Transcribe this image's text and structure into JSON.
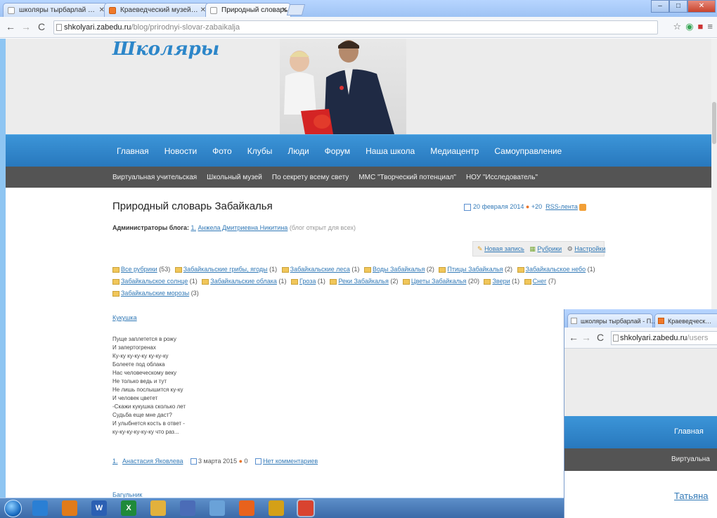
{
  "browser": {
    "tabs": [
      {
        "label": "школяры тырбарлай …",
        "icon": "page-icon",
        "active": false
      },
      {
        "label": "Краеведческий музей…",
        "icon": "site-icon",
        "active": false
      },
      {
        "label": "Природный словарь За…",
        "icon": "page-icon",
        "active": true
      }
    ],
    "url_host": "shkolyari.zabedu.ru",
    "url_path": "/blog/prirodnyi-slovar-zabaikalja"
  },
  "site": {
    "logo": "Школяры",
    "main_nav": [
      "Главная",
      "Новости",
      "Фото",
      "Клубы",
      "Люди",
      "Форум",
      "Наша школа",
      "Медиацентр",
      "Самоуправление"
    ],
    "sub_nav": [
      "Виртуальная учительская",
      "Школьный музей",
      "По секрету всему свету",
      "ММС \"Творческий потенциал\"",
      "НОУ \"Исследователь\""
    ]
  },
  "blog": {
    "title": "Природный словарь Забайкалья",
    "date": "20 февраля 2014",
    "rating": "+20",
    "rss": "RSS-лента",
    "admins_label": "Администраторы блога:",
    "admins_num": "1.",
    "admins_name": "Анжела Дмитриевна Никитина",
    "admins_note": "(блог открыт для всех)",
    "tools": [
      "Новая запись",
      "Рубрики",
      "Настройки"
    ],
    "categories": [
      {
        "name": "Все рубрики",
        "count": "(53)"
      },
      {
        "name": "Забайкальские грибы, ягоды",
        "count": "(1)"
      },
      {
        "name": "Забайкальские леса",
        "count": "(1)"
      },
      {
        "name": "Воды Забайкалья",
        "count": "(2)"
      },
      {
        "name": "Птицы Забайкалья",
        "count": "(2)"
      },
      {
        "name": "Забайкальское небо",
        "count": "(1)"
      },
      {
        "name": "Забайкальское солнце",
        "count": "(1)"
      },
      {
        "name": "Забайкальские облака",
        "count": "(1)"
      },
      {
        "name": "Гроза",
        "count": "(1)"
      },
      {
        "name": "Реки Забайкалья",
        "count": "(2)"
      },
      {
        "name": "Цветы Забайкалья",
        "count": "(20)"
      },
      {
        "name": "Звери",
        "count": "(1)"
      },
      {
        "name": "Снег",
        "count": "(7)"
      },
      {
        "name": "Забайкальские морозы",
        "count": "(3)"
      }
    ],
    "post_link": "Кукушка",
    "poem": [
      "Пуще заплетется в рожу",
      "И запертогренах",
      "Ку-ку ку-ку-ку ку-ку-ку",
      "Болеете под облака",
      "Нас человеческому веку",
      "Не только ведь и тут",
      "Не лишь послышится ку-ку",
      "И человек цветет",
      "-Скажи кукушка сколько лет",
      "Судьба еще мне даст?",
      "И улыбнется кость в ответ -",
      "ку-ку-ку-ку-ку-ку что раз..."
    ],
    "footer": {
      "num": "1.",
      "author": "Анастасия Яковлева",
      "date": "3 марта 2015",
      "rating": "0",
      "comments": "Нет комментариев"
    },
    "next_post": "Багульник"
  },
  "browser2": {
    "tabs": [
      {
        "label": "школяры тырбарлай - П…"
      },
      {
        "label": "Краеведческ…"
      }
    ],
    "url_host": "shkolyari.zabedu.ru",
    "url_path": "/users",
    "nav": "Главная",
    "sub": "Виртуальна",
    "name": "Татьяна"
  },
  "taskbar": {
    "items": [
      {
        "icon": "ie-icon",
        "color": "#2a7fd4"
      },
      {
        "icon": "media-player-icon",
        "color": "#e07b1a"
      },
      {
        "icon": "word-icon",
        "color": "#2b5fb3",
        "letter": "W"
      },
      {
        "icon": "excel-icon",
        "color": "#1f8a3a",
        "letter": "X"
      },
      {
        "icon": "folder-icon",
        "color": "#e2b13c"
      },
      {
        "icon": "app-icon",
        "color": "#4b6cb7"
      },
      {
        "icon": "paint-icon",
        "color": "#6aa2d8"
      },
      {
        "icon": "firefox-icon",
        "color": "#e8621c"
      },
      {
        "icon": "calculator-icon",
        "color": "#d4a017"
      },
      {
        "icon": "chrome-icon",
        "color": "#d9432f"
      }
    ]
  }
}
